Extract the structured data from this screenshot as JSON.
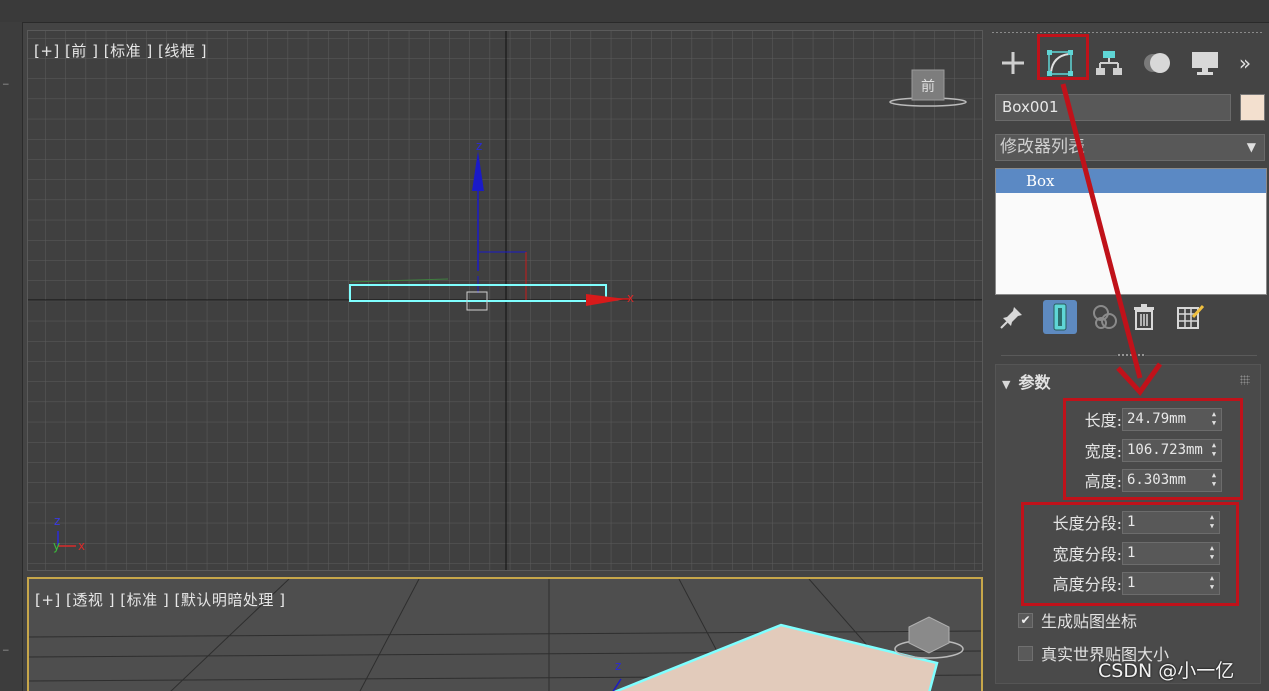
{
  "front_viewport": {
    "label": "[+] [前 ] [标准 ] [线框 ]",
    "viewcube_label": "前",
    "axis_labels": {
      "z": "z",
      "x": "x",
      "y": "y"
    }
  },
  "persp_viewport": {
    "label": "[+] [透视 ] [标准 ] [默认明暗处理 ]",
    "axis_label_z": "z"
  },
  "command_panel": {
    "tabs": [
      {
        "name": "create",
        "icon": "plus-icon"
      },
      {
        "name": "modify",
        "icon": "modify-curve-icon",
        "active": true
      },
      {
        "name": "hierarchy",
        "icon": "hierarchy-icon"
      },
      {
        "name": "motion",
        "icon": "motion-icon"
      },
      {
        "name": "display",
        "icon": "display-monitor-icon"
      },
      {
        "name": "more",
        "icon": "double-chevron-icon"
      }
    ],
    "object_name": "Box001",
    "object_color": "#f3e0cf",
    "modifier_list_label": "修改器列表",
    "modifier_stack": [
      "Box"
    ],
    "rollout_title": "参数",
    "params": [
      {
        "label": "长度:",
        "value": "24.79mm"
      },
      {
        "label": "宽度:",
        "value": "106.723mm"
      },
      {
        "label": "高度:",
        "value": "6.303mm"
      }
    ],
    "segments": [
      {
        "label": "长度分段:",
        "value": "1"
      },
      {
        "label": "宽度分段:",
        "value": "1"
      },
      {
        "label": "高度分段:",
        "value": "1"
      }
    ],
    "checkboxes": [
      {
        "label": "生成贴图坐标",
        "checked": true
      },
      {
        "label": "真实世界贴图大小",
        "checked": false
      }
    ]
  },
  "watermark": "CSDN @小一亿",
  "colors": {
    "annotation": "#c0121a",
    "selection": "#5b89c4",
    "wire": "#7fffff"
  }
}
